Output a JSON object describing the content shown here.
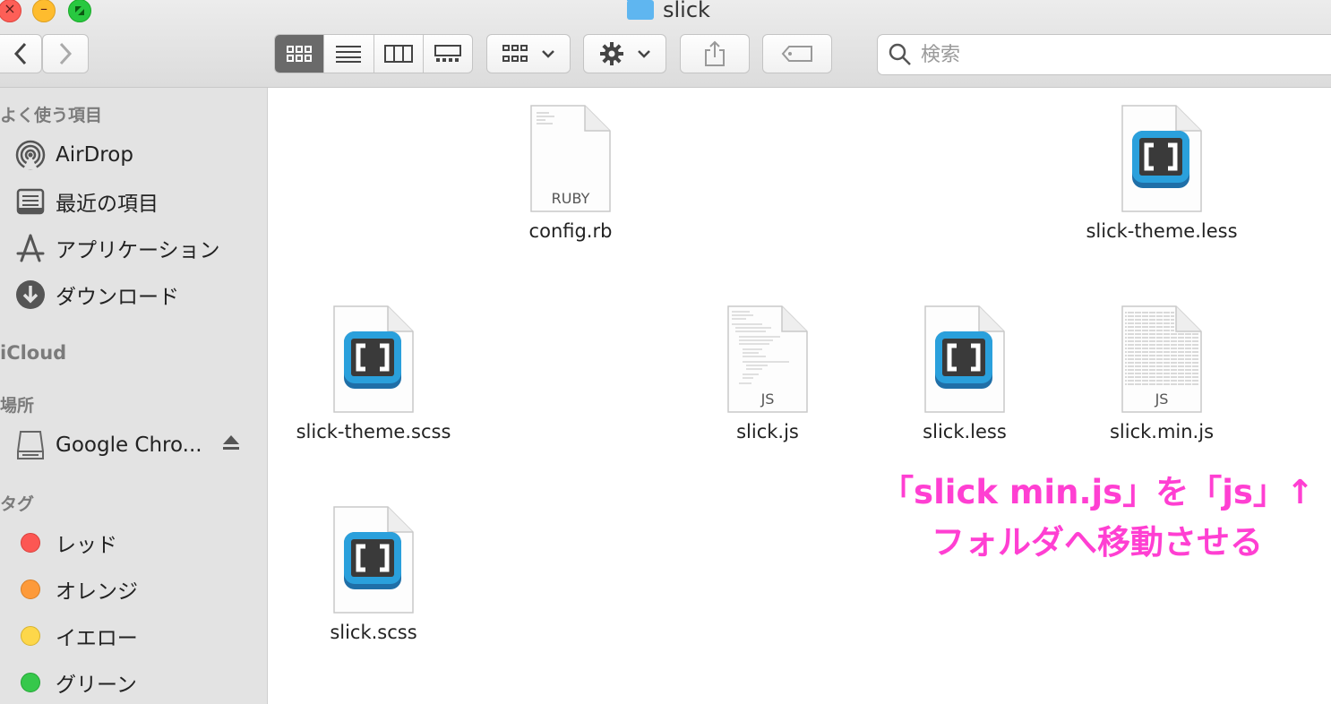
{
  "window": {
    "title": "slick"
  },
  "toolbar": {
    "search_placeholder": "検索"
  },
  "sidebar": {
    "favorites_header": "よく使う項目",
    "favorites": [
      {
        "label": "AirDrop",
        "icon": "airdrop-icon"
      },
      {
        "label": "最近の項目",
        "icon": "recents-icon"
      },
      {
        "label": "アプリケーション",
        "icon": "applications-icon"
      },
      {
        "label": "ダウンロード",
        "icon": "downloads-icon"
      }
    ],
    "icloud_header": "iCloud",
    "locations_header": "場所",
    "locations": [
      {
        "label": "Google Chro...",
        "icon": "disk-icon"
      }
    ],
    "tags_header": "タグ",
    "tags": [
      {
        "label": "レッド",
        "color": "#fc5753"
      },
      {
        "label": "オレンジ",
        "color": "#fd9a3a"
      },
      {
        "label": "イエロー",
        "color": "#fdd74a"
      },
      {
        "label": "グリーン",
        "color": "#36c84b"
      }
    ]
  },
  "files": [
    {
      "name": "config.rb",
      "type": "ruby",
      "badge": "RUBY"
    },
    {
      "name": "slick-theme.less",
      "type": "brackets"
    },
    {
      "name": "slick-theme.scss",
      "type": "brackets"
    },
    {
      "name": "slick.js",
      "type": "js",
      "badge": "JS"
    },
    {
      "name": "slick.less",
      "type": "brackets"
    },
    {
      "name": "slick.min.js",
      "type": "minjs",
      "badge": "JS"
    },
    {
      "name": "slick.scss",
      "type": "brackets"
    }
  ],
  "annotation": {
    "line1": "「slick min.js」を「js」↑",
    "line2": "フォルダへ移動させる",
    "color": "#ff3fd2"
  }
}
